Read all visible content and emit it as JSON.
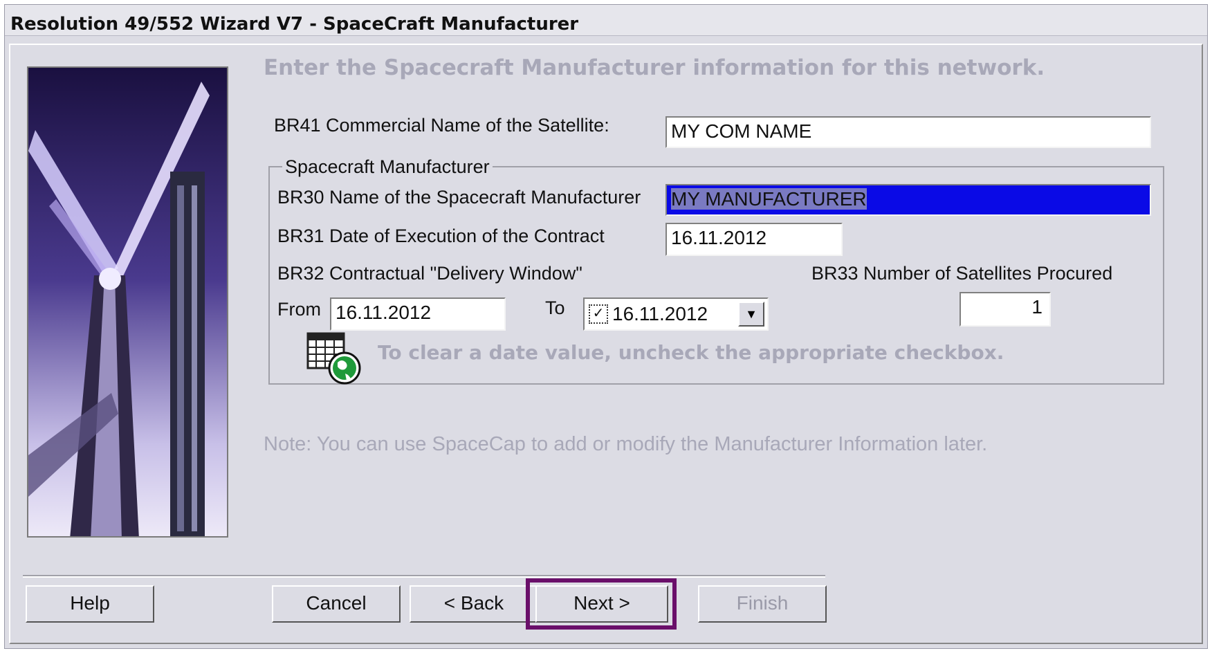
{
  "window": {
    "title": "Resolution 49/552 Wizard V7 - SpaceCraft Manufacturer"
  },
  "main": {
    "heading": "Enter the Spacecraft Manufacturer information for this network.",
    "br41": {
      "label": "BR41  Commercial Name of the Satellite:",
      "value": "MY COM NAME"
    },
    "group": {
      "legend": "Spacecraft Manufacturer",
      "br30": {
        "label": "BR30  Name of the Spacecraft Manufacturer",
        "value": "MY MANUFACTURER"
      },
      "br31": {
        "label": "BR31  Date of Execution of the Contract",
        "value": "16.11.2012"
      },
      "br32": {
        "label": "BR32  Contractual \"Delivery Window\""
      },
      "br33": {
        "label": "BR33  Number of Satellites Procured",
        "value": "1"
      },
      "from": {
        "label": "From",
        "value": "16.11.2012"
      },
      "to": {
        "label": "To",
        "value": "16.11.2012",
        "checked": true,
        "check_glyph": "✓"
      },
      "hint": "To clear a date value, uncheck the appropriate checkbox.",
      "icons": [
        "calendar-icon",
        "globe-icon",
        "dropdown-arrow-icon"
      ],
      "dropdown_glyph": "▼"
    },
    "note": "Note:  You can use SpaceCap to add or modify the Manufacturer Information later."
  },
  "buttons": {
    "help": "Help",
    "cancel": "Cancel",
    "back": "< Back",
    "next": "Next >",
    "finish": "Finish"
  },
  "colors": {
    "selection": "#0a0ae6",
    "focus_ring": "#6a0f6a",
    "dialog_bg": "#dcdce4"
  }
}
